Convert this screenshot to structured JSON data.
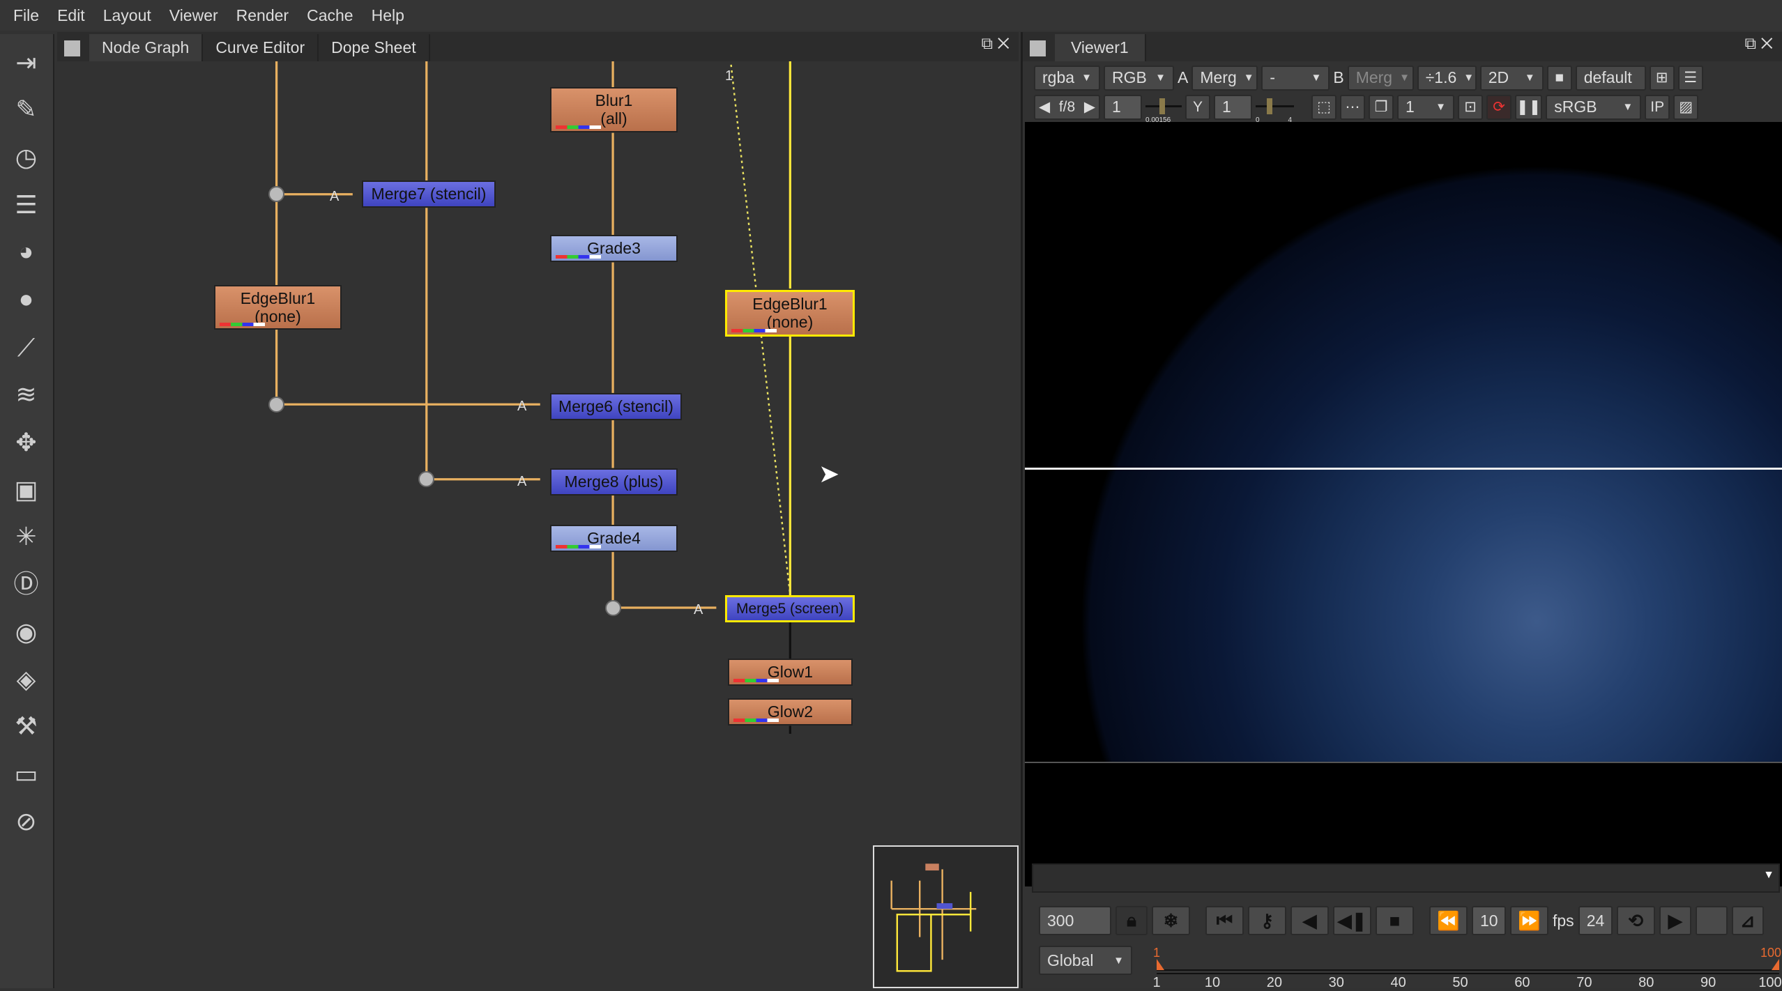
{
  "menu": [
    "File",
    "Edit",
    "Layout",
    "Viewer",
    "Render",
    "Cache",
    "Help"
  ],
  "toolbar_icons": [
    "input-icon",
    "draw-icon",
    "time-icon",
    "channel-icon",
    "color-icon",
    "filter-icon",
    "keyer-icon",
    "merge-icon",
    "transform-icon",
    "3d-icon",
    "particles-icon",
    "deep-icon",
    "views-icon",
    "metadata-icon",
    "toolsets-icon",
    "other-icon",
    "furnace-icon"
  ],
  "node_graph": {
    "tabs": [
      "Node Graph",
      "Curve Editor",
      "Dope Sheet"
    ],
    "nodes": [
      {
        "id": "blur1",
        "label": "Blur1",
        "sub": "(all)",
        "type": "orange"
      },
      {
        "id": "merge7",
        "label": "Merge7 (stencil)",
        "type": "blue"
      },
      {
        "id": "grade3",
        "label": "Grade3",
        "type": "lblue"
      },
      {
        "id": "edgeblur-left",
        "label": "EdgeBlur1",
        "sub": "(none)",
        "type": "orange"
      },
      {
        "id": "edgeblur-right",
        "label": "EdgeBlur1",
        "sub": "(none)",
        "type": "orange",
        "selected": true
      },
      {
        "id": "merge6",
        "label": "Merge6 (stencil)",
        "type": "blue"
      },
      {
        "id": "merge8",
        "label": "Merge8 (plus)",
        "type": "blue"
      },
      {
        "id": "grade4",
        "label": "Grade4",
        "type": "lblue"
      },
      {
        "id": "merge5",
        "label": "Merge5 (screen)",
        "type": "blue",
        "selected": true
      },
      {
        "id": "glow1",
        "label": "Glow1",
        "type": "orange"
      },
      {
        "id": "glow2",
        "label": "Glow2",
        "type": "orange"
      }
    ],
    "input_label": "A",
    "expr_label": "1"
  },
  "viewer": {
    "tab": "Viewer1",
    "channels": "rgba",
    "display": "RGB",
    "a_label": "A",
    "a_input": "Merg",
    "mid": "-",
    "b_label": "B",
    "b_input": "Merg",
    "downscale": "÷1.6",
    "mode": "2D",
    "lut": "default",
    "fstop": "f/8",
    "gain": "1",
    "gain_range": "0.00156",
    "gamma_label": "Y",
    "gamma": "1",
    "gamma_range": [
      "0",
      "4"
    ],
    "proxy": "1",
    "colorspace": "sRGB",
    "ip": "IP"
  },
  "timeline": {
    "frame": "300",
    "step": "10",
    "fps_label": "fps",
    "fps": "24",
    "range_mode": "Global",
    "in": "1",
    "out": "100",
    "ticks": [
      "1",
      "10",
      "20",
      "30",
      "40",
      "50",
      "60",
      "70",
      "80",
      "90",
      "100"
    ]
  },
  "colors": {
    "node_orange": "#c98060",
    "node_blue": "#5155d0",
    "node_lightblue": "#95a6db",
    "selection": "#ffea00",
    "wire": "#e8b060",
    "in_out_marker": "#e86a30"
  }
}
